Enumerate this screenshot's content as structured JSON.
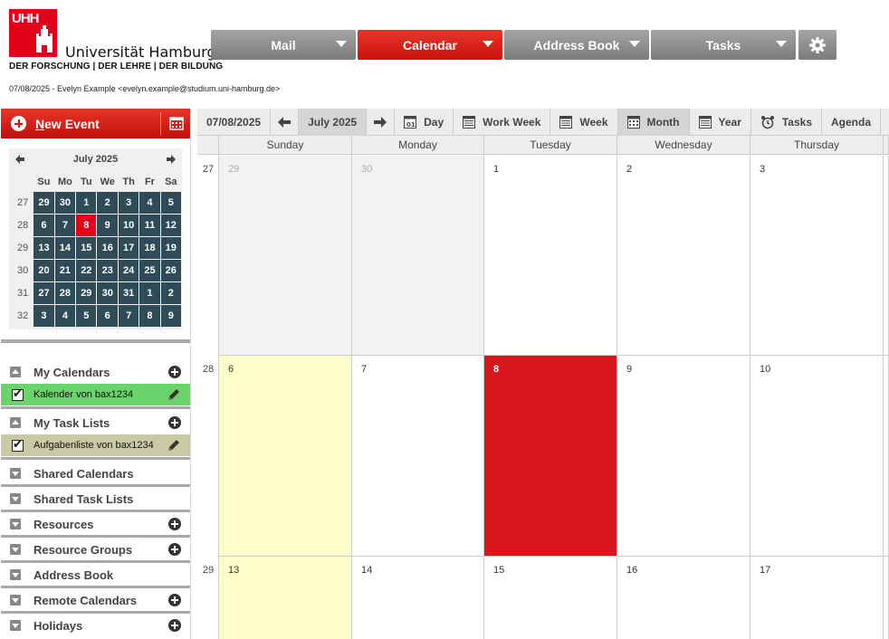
{
  "branding": {
    "logo_text": "UHH",
    "university_name": "Universität Hamburg",
    "tagline": "DER FORSCHUNG | DER LEHRE | DER BILDUNG",
    "brand_color": "#e2001a"
  },
  "user_line": "07/08/2025 - Evelyn Example <evelyn.example@studium.uni-hamburg.de>",
  "topnav": {
    "tabs": [
      {
        "label": "Mail"
      },
      {
        "label": "Calendar",
        "active": true
      },
      {
        "label": "Address Book"
      },
      {
        "label": "Tasks"
      }
    ],
    "settings_icon": "gear-icon"
  },
  "sidebar": {
    "new_event_label": "New Event",
    "mini_calendar": {
      "title": "July 2025",
      "weekdays": [
        "Su",
        "Mo",
        "Tu",
        "We",
        "Th",
        "Fr",
        "Sa"
      ],
      "weeks": [
        {
          "week": "27",
          "days": [
            "29",
            "30",
            "1",
            "2",
            "3",
            "4",
            "5"
          ]
        },
        {
          "week": "28",
          "days": [
            "6",
            "7",
            "8",
            "9",
            "10",
            "11",
            "12"
          ]
        },
        {
          "week": "29",
          "days": [
            "13",
            "14",
            "15",
            "16",
            "17",
            "18",
            "19"
          ]
        },
        {
          "week": "30",
          "days": [
            "20",
            "21",
            "22",
            "23",
            "24",
            "25",
            "26"
          ]
        },
        {
          "week": "31",
          "days": [
            "27",
            "28",
            "29",
            "30",
            "31",
            "1",
            "2"
          ]
        },
        {
          "week": "32",
          "days": [
            "3",
            "4",
            "5",
            "6",
            "7",
            "8",
            "9"
          ]
        }
      ],
      "today": "8"
    },
    "my_calendars": {
      "label": "My Calendars",
      "items": [
        {
          "label": "Kalender von bax1234",
          "color": "#6ad46a"
        }
      ]
    },
    "my_task_lists": {
      "label": "My Task Lists",
      "items": [
        {
          "label": "Aufgabenliste von bax1234",
          "color": "#c8caa4"
        }
      ]
    },
    "sections": [
      {
        "label": "Shared Calendars",
        "add": false
      },
      {
        "label": "Shared Task Lists",
        "add": false
      },
      {
        "label": "Resources",
        "add": true
      },
      {
        "label": "Resource Groups",
        "add": true
      },
      {
        "label": "Address Book",
        "add": false
      },
      {
        "label": "Remote Calendars",
        "add": true
      },
      {
        "label": "Holidays",
        "add": true
      }
    ]
  },
  "toolbar": {
    "date": "07/08/2025",
    "period": "July 2025",
    "views": [
      {
        "label": "Day",
        "icon": "day-icon"
      },
      {
        "label": "Work Week",
        "icon": "workweek-icon"
      },
      {
        "label": "Week",
        "icon": "week-icon"
      },
      {
        "label": "Month",
        "icon": "month-icon",
        "active": true
      },
      {
        "label": "Year",
        "icon": "year-icon"
      },
      {
        "label": "Tasks",
        "icon": "alarm-clock-icon"
      },
      {
        "label": "Agenda",
        "icon": ""
      }
    ]
  },
  "month_view": {
    "day_headers": [
      "Sunday",
      "Monday",
      "Tuesday",
      "Wednesday",
      "Thursday"
    ],
    "weeks": [
      {
        "week": "27",
        "days": [
          "29",
          "30",
          "1",
          "2",
          "3"
        ]
      },
      {
        "week": "28",
        "days": [
          "6",
          "7",
          "8",
          "9",
          "10"
        ]
      },
      {
        "week": "29",
        "days": [
          "13",
          "14",
          "15",
          "16",
          "17"
        ]
      }
    ],
    "today": "8",
    "colors": {
      "weekend": "#ffffcc",
      "today": "#d8161c",
      "outside_month": "#f2f2f2"
    }
  }
}
